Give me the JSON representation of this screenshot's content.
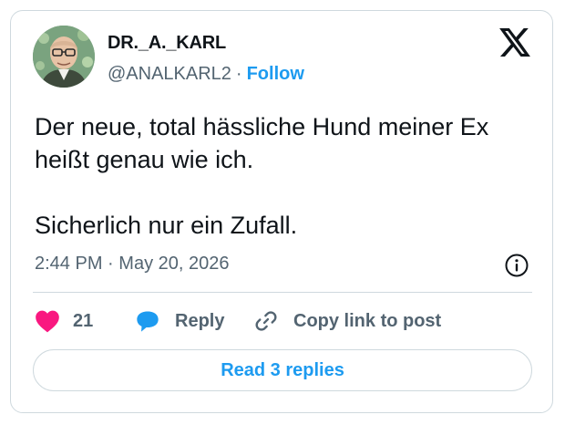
{
  "author": {
    "display_name": "DR._A._KARL",
    "handle": "@ANALKARL2",
    "separator": "·",
    "follow_label": "Follow"
  },
  "tweet": {
    "text": "Der neue, total hässliche Hund meiner Ex\nheißt genau wie ich.\n\nSicherlich nur ein Zufall.",
    "time": "2:44 PM",
    "date_separator": "·",
    "date": "May 20, 2026"
  },
  "actions": {
    "like_count": "21",
    "reply_label": "Reply",
    "copy_label": "Copy link to post"
  },
  "read_replies_label": "Read 3 replies",
  "icons": {
    "logo": "x-logo-icon",
    "info": "info-icon",
    "like": "heart-icon",
    "reply": "speech-bubble-icon",
    "copy": "link-icon"
  },
  "colors": {
    "accent": "#1d9bf0",
    "like": "#f91880",
    "text": "#0f1419",
    "secondary": "#536471",
    "border": "#cfd9de"
  }
}
